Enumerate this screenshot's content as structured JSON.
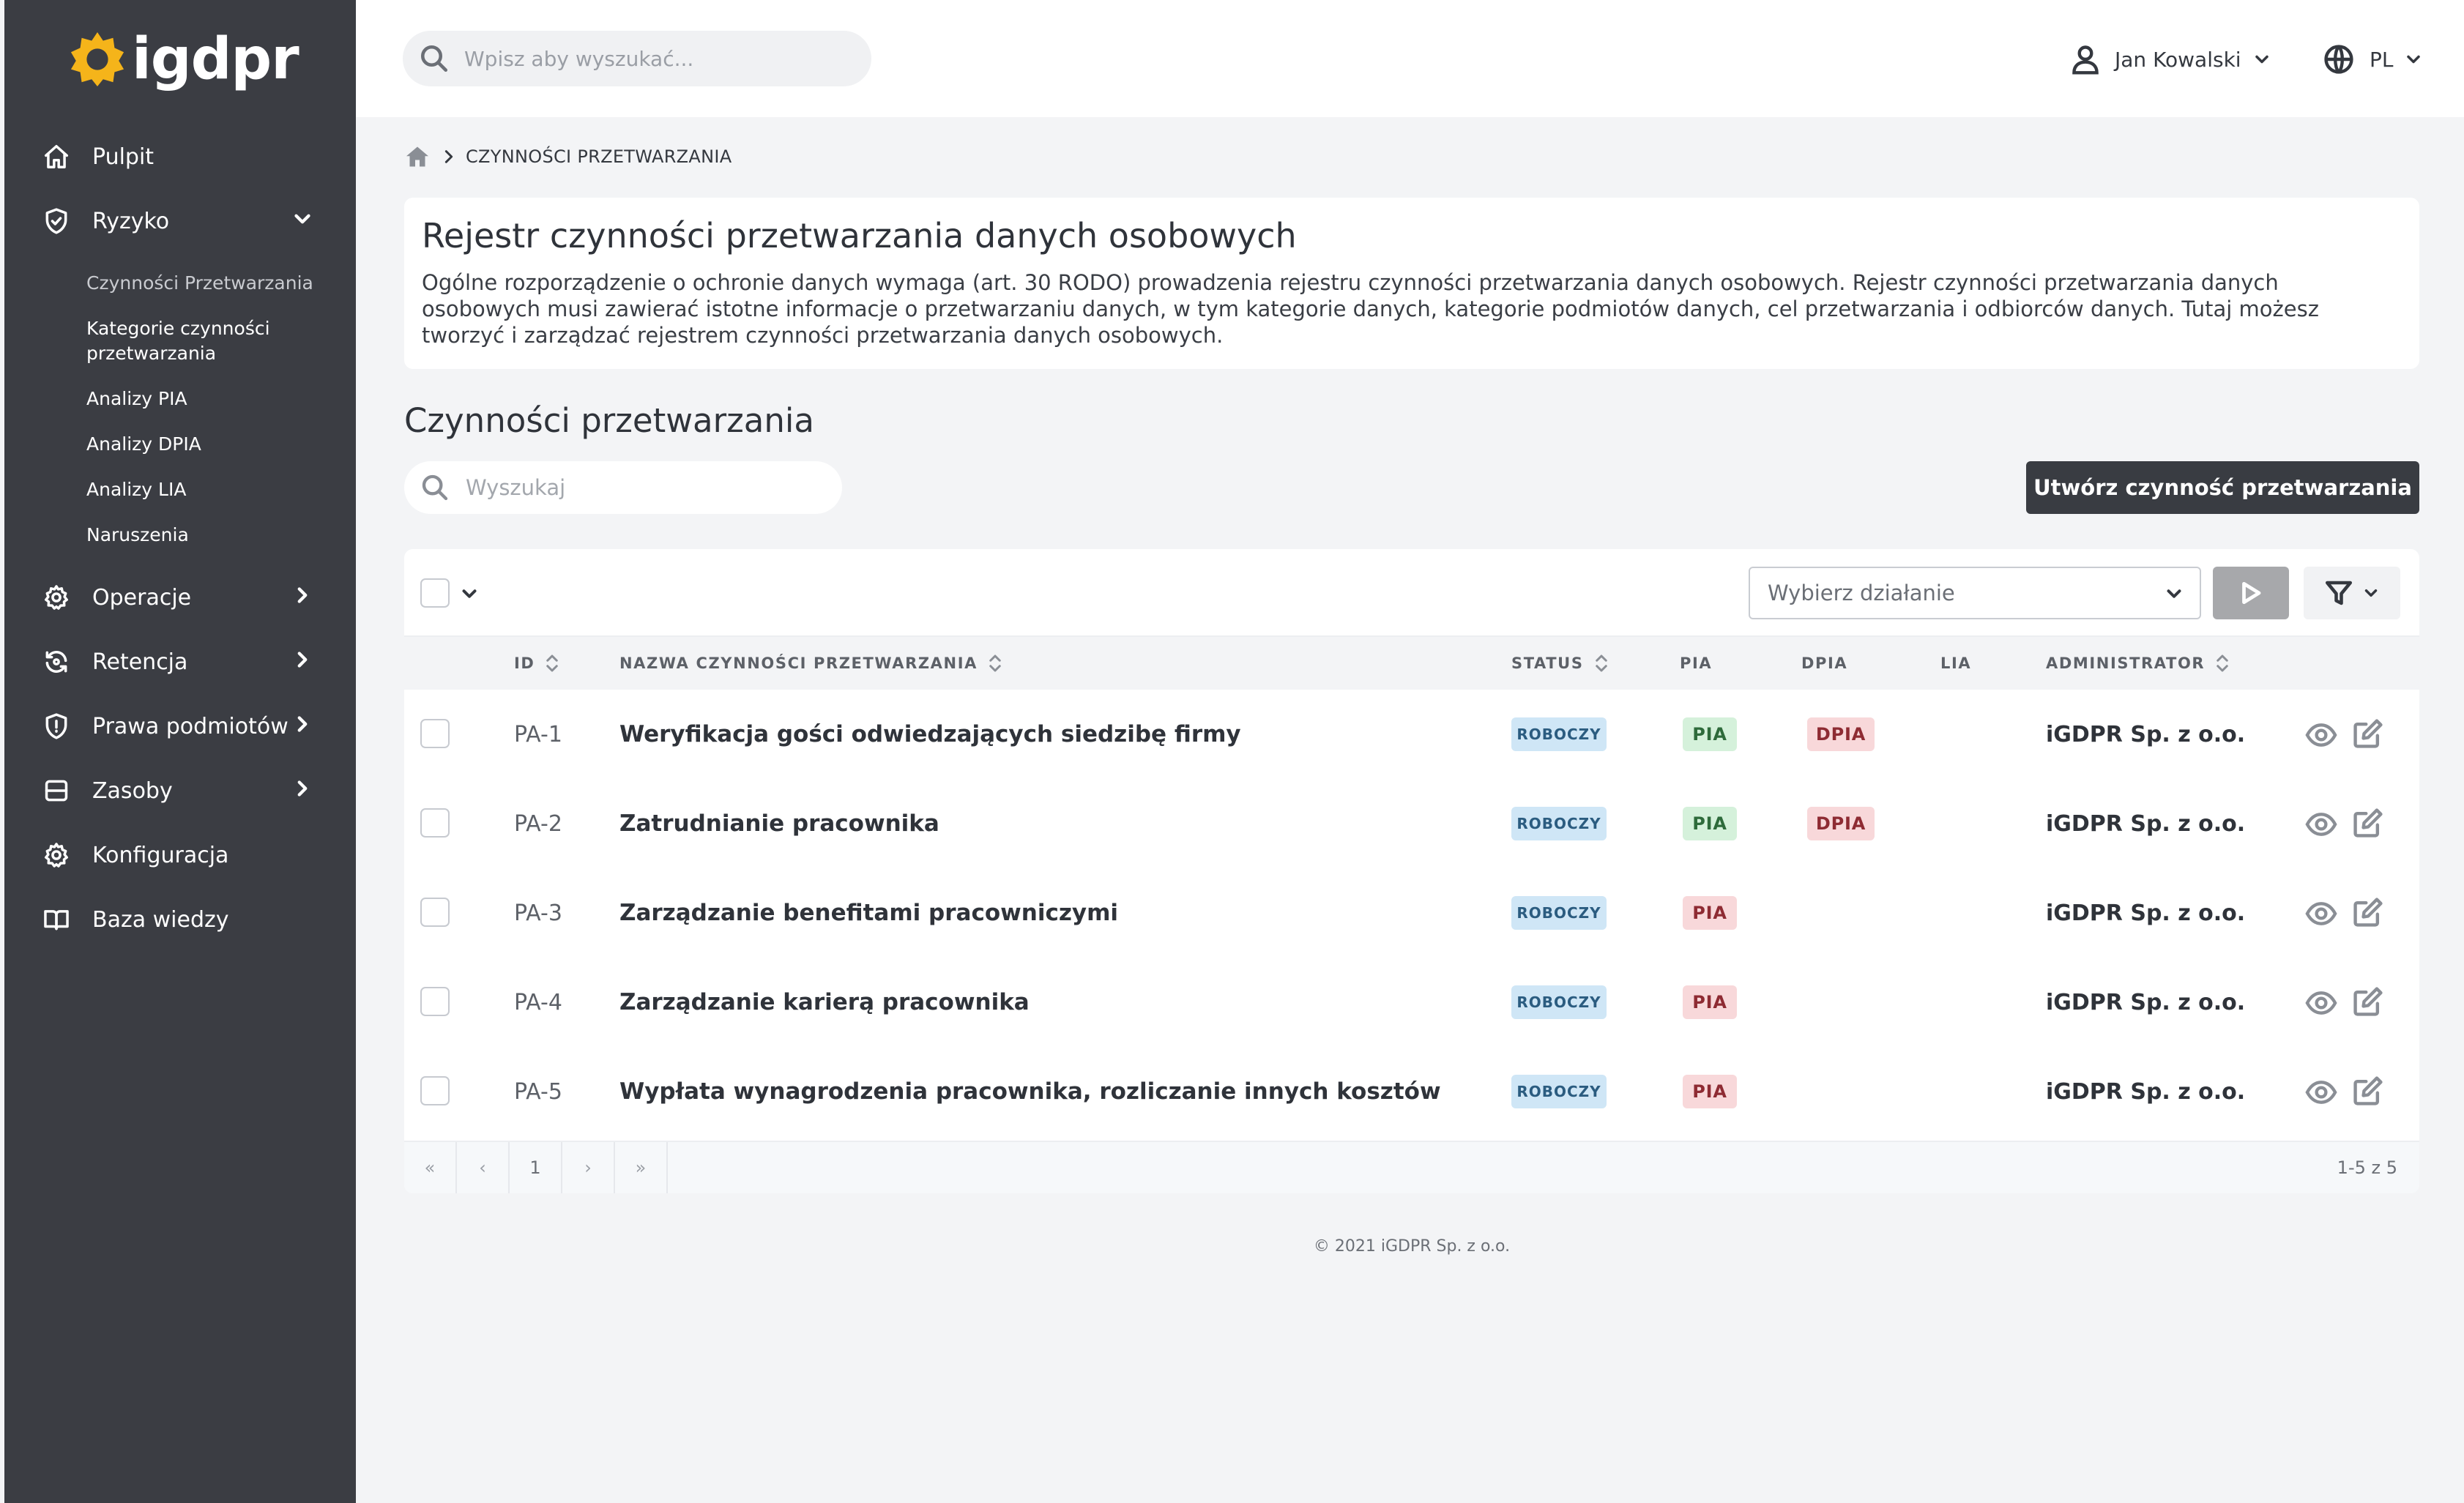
{
  "app": {
    "logo_text": "igdpr",
    "logo_color": "#f5b41a"
  },
  "sidebar": {
    "items": [
      {
        "label": "Pulpit",
        "icon": "home-icon"
      },
      {
        "label": "Ryzyko",
        "icon": "shield-icon",
        "expanded": true,
        "children": [
          {
            "label": "Czynności Przetwarzania",
            "active": true
          },
          {
            "label": "Kategorie czynności przetwarzania"
          },
          {
            "label": "Analizy PIA"
          },
          {
            "label": "Analizy DPIA"
          },
          {
            "label": "Analizy LIA"
          },
          {
            "label": "Naruszenia"
          }
        ]
      },
      {
        "label": "Operacje",
        "icon": "gear-icon"
      },
      {
        "label": "Retencja",
        "icon": "refresh-icon"
      },
      {
        "label": "Prawa podmiotów",
        "icon": "shield-alert-icon"
      },
      {
        "label": "Zasoby",
        "icon": "database-icon"
      },
      {
        "label": "Konfiguracja",
        "icon": "settings-icon"
      },
      {
        "label": "Baza wiedzy",
        "icon": "book-icon"
      }
    ]
  },
  "header": {
    "search_placeholder": "Wpisz aby wyszukać...",
    "user_name": "Jan Kowalski",
    "language": "PL"
  },
  "breadcrumb": {
    "current": "CZYNNOŚCI PRZETWARZANIA"
  },
  "info": {
    "title": "Rejestr czynności przetwarzania danych osobowych",
    "description": "Ogólne rozporządzenie o ochronie danych wymaga (art. 30 RODO) prowadzenia rejestru czynności przetwarzania danych osobowych. Rejestr czynności przetwarzania danych osobowych musi zawierać istotne informacje o przetwarzaniu danych, w tym kategorie danych, kategorie podmiotów danych, cel przetwarzania i odbiorców danych. Tutaj możesz tworzyć i zarządzać rejestrem czynności przetwarzania danych osobowych."
  },
  "list": {
    "section_title": "Czynności przetwarzania",
    "search_placeholder": "Wyszukaj",
    "create_button": "Utwórz czynność przetwarzania",
    "action_select_placeholder": "Wybierz działanie",
    "columns": {
      "id": "ID",
      "name": "NAZWA CZYNNOŚCI PRZETWARZANIA",
      "status": "STATUS",
      "pia": "PIA",
      "dpia": "DPIA",
      "lia": "LIA",
      "admin": "ADMINISTRATOR"
    },
    "rows": [
      {
        "id": "PA-1",
        "name": "Weryfikacja gości odwiedzających siedzibę firmy",
        "status": "ROBOCZY",
        "pia": "PIA",
        "pia_state": "green",
        "dpia": "DPIA",
        "dpia_state": "red",
        "admin": "iGDPR Sp. z o.o."
      },
      {
        "id": "PA-2",
        "name": "Zatrudnianie pracownika",
        "status": "ROBOCZY",
        "pia": "PIA",
        "pia_state": "green",
        "dpia": "DPIA",
        "dpia_state": "red",
        "admin": "iGDPR Sp. z o.o."
      },
      {
        "id": "PA-3",
        "name": "Zarządzanie benefitami pracowniczymi",
        "status": "ROBOCZY",
        "pia": "PIA",
        "pia_state": "red",
        "dpia": "",
        "dpia_state": "",
        "admin": "iGDPR Sp. z o.o."
      },
      {
        "id": "PA-4",
        "name": "Zarządzanie karierą pracownika",
        "status": "ROBOCZY",
        "pia": "PIA",
        "pia_state": "red",
        "dpia": "",
        "dpia_state": "",
        "admin": "iGDPR Sp. z o.o."
      },
      {
        "id": "PA-5",
        "name": "Wypłata wynagrodzenia pracownika, rozliczanie innych kosztów",
        "status": "ROBOCZY",
        "pia": "PIA",
        "pia_state": "red",
        "dpia": "",
        "dpia_state": "",
        "admin": "iGDPR Sp. z o.o."
      }
    ],
    "pagination": {
      "first": "«",
      "prev": "‹",
      "page": "1",
      "next": "›",
      "last": "»",
      "range": "1-5 z 5"
    }
  },
  "footer": {
    "text": "© 2021 iGDPR Sp. z o.o."
  },
  "colors": {
    "sidebar_bg": "#3b3d43",
    "primary_button": "#393c42",
    "status_badge_bg": "#cfe6f6",
    "pia_ok_bg": "#d5f1db",
    "pia_alert_bg": "#f8d8da"
  }
}
